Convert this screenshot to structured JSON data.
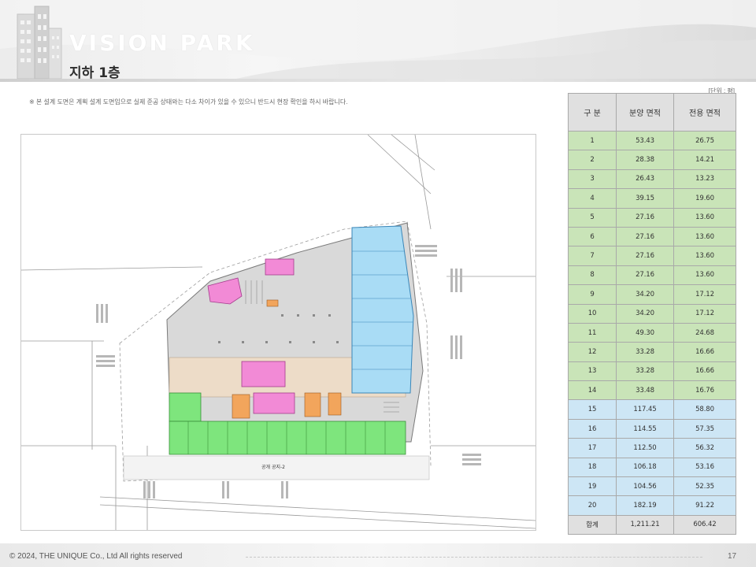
{
  "header": {
    "brand": "VISION PARK",
    "page_title": "지하 1층"
  },
  "note": "※ 본 설계 도면은 계획 설계 도면임으로 실제 준공 상태와는 다소 차이가 있을 수 있으니 반드시 현장 확인을 하시 바랍니다.",
  "unit": "[단위 : 평]",
  "plan": {
    "label_public_space": "공개 공지-2"
  },
  "table": {
    "headers": [
      "구 분",
      "분양 면적",
      "전용 면적"
    ],
    "rows": [
      {
        "no": "1",
        "sale": "53.43",
        "exclusive": "26.75",
        "group": "retail"
      },
      {
        "no": "2",
        "sale": "28.38",
        "exclusive": "14.21",
        "group": "retail"
      },
      {
        "no": "3",
        "sale": "26.43",
        "exclusive": "13.23",
        "group": "retail"
      },
      {
        "no": "4",
        "sale": "39.15",
        "exclusive": "19.60",
        "group": "retail"
      },
      {
        "no": "5",
        "sale": "27.16",
        "exclusive": "13.60",
        "group": "retail"
      },
      {
        "no": "6",
        "sale": "27.16",
        "exclusive": "13.60",
        "group": "retail"
      },
      {
        "no": "7",
        "sale": "27.16",
        "exclusive": "13.60",
        "group": "retail"
      },
      {
        "no": "8",
        "sale": "27.16",
        "exclusive": "13.60",
        "group": "retail"
      },
      {
        "no": "9",
        "sale": "34.20",
        "exclusive": "17.12",
        "group": "retail"
      },
      {
        "no": "10",
        "sale": "34.20",
        "exclusive": "17.12",
        "group": "retail"
      },
      {
        "no": "11",
        "sale": "49.30",
        "exclusive": "24.68",
        "group": "retail"
      },
      {
        "no": "12",
        "sale": "33.28",
        "exclusive": "16.66",
        "group": "retail"
      },
      {
        "no": "13",
        "sale": "33.28",
        "exclusive": "16.66",
        "group": "retail"
      },
      {
        "no": "14",
        "sale": "33.48",
        "exclusive": "16.76",
        "group": "retail"
      },
      {
        "no": "15",
        "sale": "117.45",
        "exclusive": "58.80",
        "group": "large"
      },
      {
        "no": "16",
        "sale": "114.55",
        "exclusive": "57.35",
        "group": "large"
      },
      {
        "no": "17",
        "sale": "112.50",
        "exclusive": "56.32",
        "group": "large"
      },
      {
        "no": "18",
        "sale": "106.18",
        "exclusive": "53.16",
        "group": "large"
      },
      {
        "no": "19",
        "sale": "104.56",
        "exclusive": "52.35",
        "group": "large"
      },
      {
        "no": "20",
        "sale": "182.19",
        "exclusive": "91.22",
        "group": "large"
      }
    ],
    "total": {
      "label": "합계",
      "sale": "1,211.21",
      "exclusive": "606.42"
    }
  },
  "colors": {
    "retail_green": "#c9e4b8",
    "large_blue": "#cde6f5",
    "header_gray": "#e0e0e0"
  },
  "footer": {
    "copyright": "© 2024, THE UNIQUE Co., Ltd  All rights reserved",
    "page_number": "17"
  }
}
